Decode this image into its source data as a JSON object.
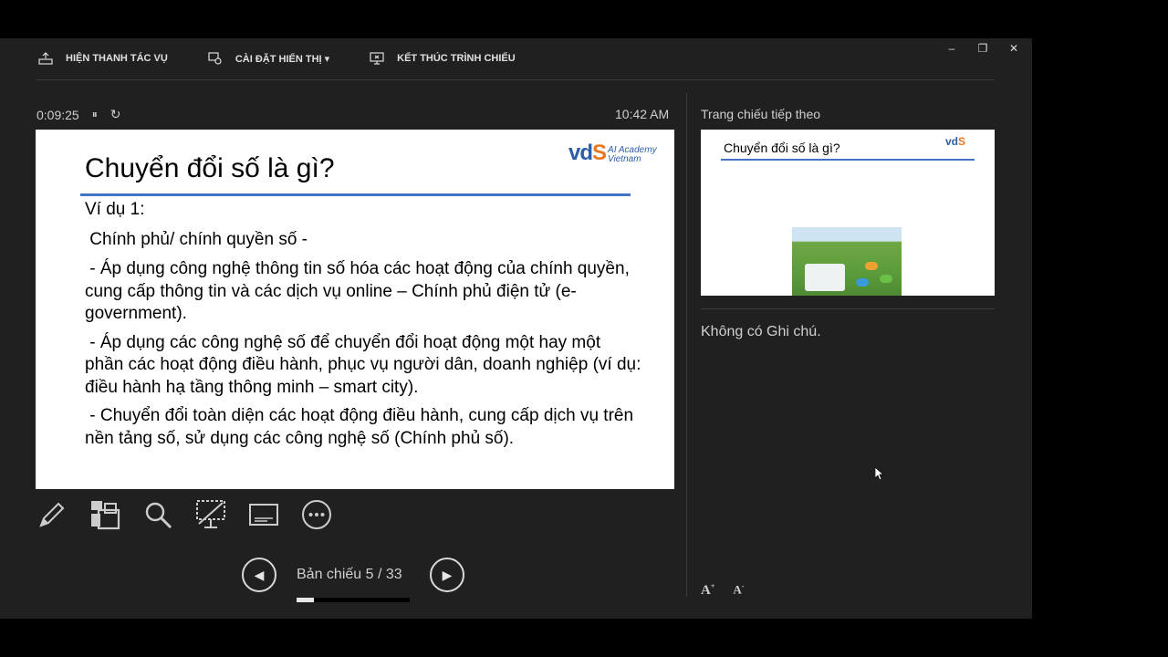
{
  "window": {
    "minimize": "–",
    "restore": "❐",
    "close": "✕"
  },
  "toolbar": {
    "show_taskbar": "HIỆN THANH TÁC VỤ",
    "display_settings": "CÀI ĐẶT HIỂN THỊ ▾",
    "end_show": "KẾT THÚC TRÌNH CHIẾU"
  },
  "timer": {
    "elapsed": "0:09:25",
    "pause_icon": "⏸",
    "reset_icon": "↻"
  },
  "clock": "10:42 AM",
  "slide": {
    "title": "Chuyển đổi số là gì?",
    "logo_main": "vd",
    "logo_accent": "S",
    "logo_line1": "AI Academy",
    "logo_line2": "Vietnam",
    "paragraphs": [
      "Ví dụ 1:",
      " Chính phủ/ chính quyền số -",
      " - Áp dụng công nghệ thông tin số hóa các hoạt động của chính quyền, cung cấp thông tin và các dịch vụ online – Chính phủ điện tử (e-government).",
      " - Áp dụng các công nghệ số để chuyển đổi hoạt động một hay một phần các hoạt động điều hành, phục vụ người dân, doanh nghiệp (ví dụ: điều hành hạ tầng thông minh – smart city).",
      " - Chuyển đổi toàn diện các hoạt động điều hành, cung cấp dịch vụ trên nền tảng số, sử dụng các công nghệ số (Chính phủ số)."
    ]
  },
  "navigation": {
    "prev_icon": "◀",
    "next_icon": "▶",
    "slide_counter": "Bản chiếu 5 / 33",
    "progress_fraction": 0.1515
  },
  "next_panel": {
    "label": "Trang chiếu tiếp theo",
    "title": "Chuyển đổi số là gì?",
    "logo_main": "vd",
    "logo_accent": "S"
  },
  "notes": "Không có Ghi chú.",
  "font_controls": {
    "increase": "A",
    "decrease": "A"
  },
  "colors": {
    "accent_blue": "#4472c4",
    "logo_orange": "#e87722",
    "background": "#202020"
  }
}
